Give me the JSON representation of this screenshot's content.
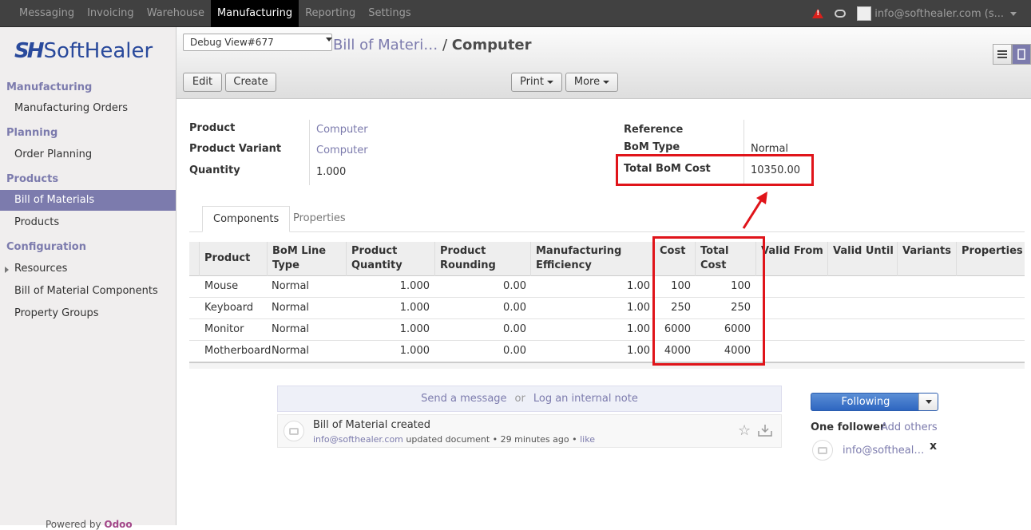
{
  "topbar": {
    "menu": [
      "Messaging",
      "Invoicing",
      "Warehouse",
      "Manufacturing",
      "Reporting",
      "Settings"
    ],
    "active": "Manufacturing",
    "user": "info@softhealer.com (s..."
  },
  "logo": {
    "mark": "SH",
    "word": "SoftHealer"
  },
  "sidebar": {
    "sections": [
      {
        "title": "Manufacturing",
        "items": [
          "Manufacturing Orders"
        ]
      },
      {
        "title": "Planning",
        "items": [
          "Order Planning"
        ]
      },
      {
        "title": "Products",
        "items": [
          "Bill of Materials",
          "Products"
        ]
      },
      {
        "title": "Configuration",
        "items": [
          "Resources",
          "Bill of Material Components",
          "Property Groups"
        ]
      }
    ],
    "powered_prefix": "Powered by",
    "powered_brand": "Odoo"
  },
  "control": {
    "debug": "Debug View#677",
    "crumb_parent": "Bill of Materi…",
    "crumb_sep": "/",
    "crumb_current": "Computer",
    "edit": "Edit",
    "create": "Create",
    "print": "Print",
    "more": "More"
  },
  "form": {
    "product_label": "Product",
    "product": "Computer",
    "variant_label": "Product Variant",
    "variant": "Computer",
    "qty_label": "Quantity",
    "qty": "1.000",
    "ref_label": "Reference",
    "bomtype_label": "BoM Type",
    "bomtype": "Normal",
    "total_label": "Total BoM Cost",
    "total": "10350.00"
  },
  "tabs": [
    "Components",
    "Properties"
  ],
  "grid": {
    "headers": {
      "product": "Product",
      "bom_line_type": "BoM Line Type",
      "product_quantity": "Product Quantity",
      "product_rounding": "Product Rounding",
      "manufacturing_efficiency": "Manufacturing Efficiency",
      "cost": "Cost",
      "total_cost": "Total Cost",
      "valid_from": "Valid From",
      "valid_until": "Valid Until",
      "variants": "Variants",
      "properties": "Properties"
    },
    "rows": [
      {
        "product": "Mouse",
        "type": "Normal",
        "qty": "1.000",
        "rounding": "0.00",
        "eff": "1.00",
        "cost": "100",
        "total": "100"
      },
      {
        "product": "Keyboard",
        "type": "Normal",
        "qty": "1.000",
        "rounding": "0.00",
        "eff": "1.00",
        "cost": "250",
        "total": "250"
      },
      {
        "product": "Monitor",
        "type": "Normal",
        "qty": "1.000",
        "rounding": "0.00",
        "eff": "1.00",
        "cost": "6000",
        "total": "6000"
      },
      {
        "product": "Motherboard",
        "type": "Normal",
        "qty": "1.000",
        "rounding": "0.00",
        "eff": "1.00",
        "cost": "4000",
        "total": "4000"
      }
    ]
  },
  "chatter": {
    "send": "Send a message",
    "or": "or",
    "log": "Log an internal note",
    "message_title": "Bill of Material created",
    "message_author": "info@softhealer.com",
    "message_action": "updated document",
    "message_time": "29 minutes ago",
    "message_like": "like",
    "following": "Following",
    "followers": "One follower",
    "add_others": "Add others",
    "follower_name": "info@softheal…",
    "remove": "x"
  }
}
